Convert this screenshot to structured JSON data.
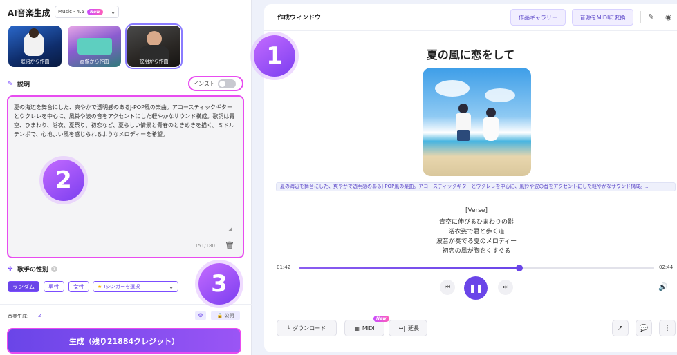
{
  "left": {
    "app_title": "AI音楽生成",
    "model": {
      "label": "Music - 4.5",
      "badge": "New"
    },
    "modes": [
      {
        "label": "歌詞から作曲"
      },
      {
        "label": "画像から作曲"
      },
      {
        "label": "説明から作曲"
      }
    ],
    "description": {
      "heading": "説明",
      "instrumental_label": "インスト",
      "text": "夏の海辺を舞台にした、爽やかで透明感のあるJ-POP風の楽曲。アコースティックギターとウクレレを中心に、風鈴や波の音をアクセントにした軽やかなサウンド構成。歌詞は青空、ひまわり、浴衣、夏祭り、初恋など、夏らしい情景と青春のときめきを描く。ミドルテンポで、心地よい風を感じられるようなメロディーを希望。",
      "counter": "151/180"
    },
    "gender": {
      "heading": "歌手の性別",
      "options": [
        "ランダム",
        "男性",
        "女性"
      ],
      "singer_select": "!シンガーを選択"
    },
    "gen_count_label": "音楽生成:",
    "gen_count_value": "2",
    "public_label": "公開",
    "generate_button": "生成（残り21884クレジット）"
  },
  "steps": [
    "1",
    "2",
    "3"
  ],
  "right": {
    "window_title": "作成ウィンドウ",
    "gallery_button": "作品ギャラリー",
    "midi_convert_button": "音源をMIDIに変換",
    "song_title": "夏の風に恋をして",
    "prompt_preview": "夏の海辺を舞台にした、爽やかで透明感のあるJ-POP風の楽曲。アコースティックギターとウクレレを中心に、風鈴や波の音をアクセントにした軽やかなサウンド構成。...",
    "lyrics": [
      "[Verse]",
      "青空に伸びるひまわりの影",
      "浴衣姿で君と歩く道",
      "波音が奏でる夏のメロディー",
      "初恋の風が胸をくすぐる"
    ],
    "time_current": "01:42",
    "time_total": "02:44",
    "progress": 0.62,
    "download_label": "ダウンロード",
    "midi_label": "MIDI",
    "midi_badge": "New",
    "extend_label": "延長"
  }
}
